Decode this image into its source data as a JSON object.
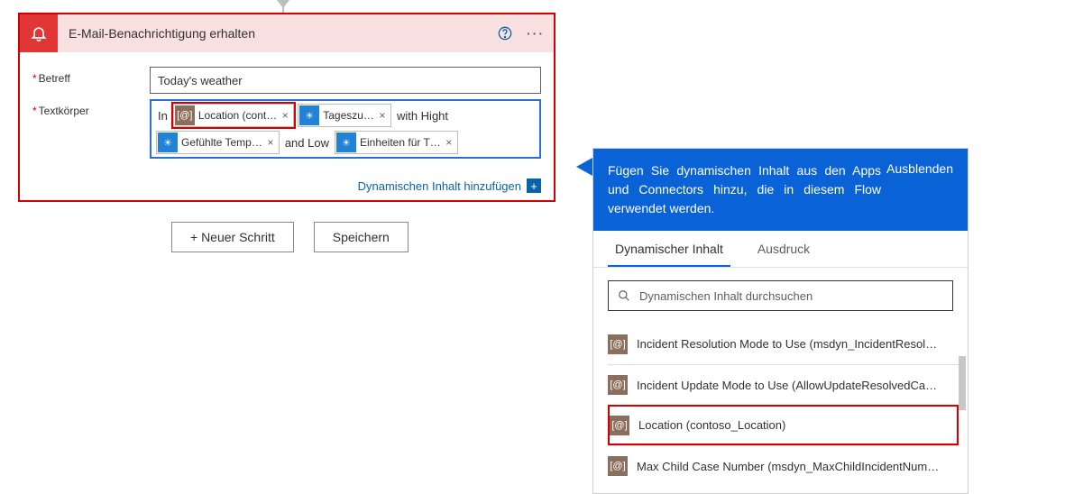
{
  "card": {
    "title": "E-Mail-Benachrichtigung erhalten",
    "subject_label": "Betreff",
    "subject_value": "Today's weather",
    "body_label": "Textkörper",
    "tokens": {
      "t0": "In",
      "loc_label": "Location (cont…",
      "day_label": "Tageszu…",
      "t1": "with Hight",
      "feels_label": "Gefühlte Temp…",
      "t2": "and Low",
      "units_label": "Einheiten für T…"
    },
    "add_content": "Dynamischen Inhalt hinzufügen"
  },
  "buttons": {
    "new_step": "+ Neuer Schritt",
    "save": "Speichern"
  },
  "panel": {
    "blurb": "Fügen Sie dynamischen Inhalt aus den Apps und Connectors hinzu, die in diesem Flow verwendet werden.",
    "hide": "Ausblenden",
    "tab_dynamic": "Dynamischer Inhalt",
    "tab_expr": "Ausdruck",
    "search_placeholder": "Dynamischen Inhalt durchsuchen",
    "items": [
      "Incident Resolution Mode to Use (msdyn_IncidentResol…",
      "Incident Update Mode to Use (AllowUpdateResolvedCa…",
      "Location (contoso_Location)",
      "Max Child Case Number (msdyn_MaxChildIncidentNum…"
    ]
  },
  "icons": {
    "bell": "bell-icon",
    "help": "?",
    "menu": "···",
    "at": "[@]",
    "sun": "☀",
    "close": "×",
    "plus": "+",
    "search": "🔍"
  }
}
